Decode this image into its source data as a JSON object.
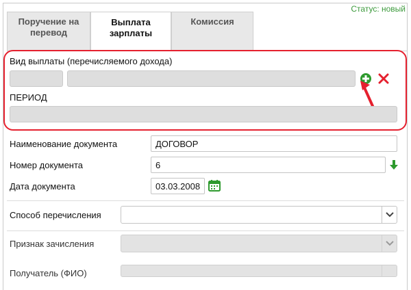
{
  "status": {
    "text": "Статус: новый"
  },
  "tabs": [
    {
      "line1": "Поручение на",
      "line2": "перевод",
      "active": false
    },
    {
      "line1": "Выплата",
      "line2": "зарплаты",
      "active": true
    },
    {
      "line1": "Комиссия",
      "line2": "",
      "active": false
    }
  ],
  "payout": {
    "label": "Вид выплаты (перечисляемого дохода)",
    "code_value": "",
    "name_value": "",
    "add_icon": "plus-circle-icon",
    "remove_icon": "close-icon"
  },
  "period": {
    "label": "ПЕРИОД",
    "value": ""
  },
  "document": {
    "name_label": "Наименование документа",
    "name_value": "ДОГОВОР",
    "number_label": "Номер документа",
    "number_value": "6",
    "date_label": "Дата документа",
    "date_value": "03.03.2008"
  },
  "transfer": {
    "method_label": "Способ перечисления",
    "method_value": "",
    "credit_label": "Признак зачисления",
    "credit_value": "",
    "recipient_label": "Получатель (ФИО)",
    "recipient_value": ""
  },
  "colors": {
    "accent_green": "#2e9a2e",
    "callout_red": "#e5202e",
    "status_green": "#3c9a3c"
  }
}
